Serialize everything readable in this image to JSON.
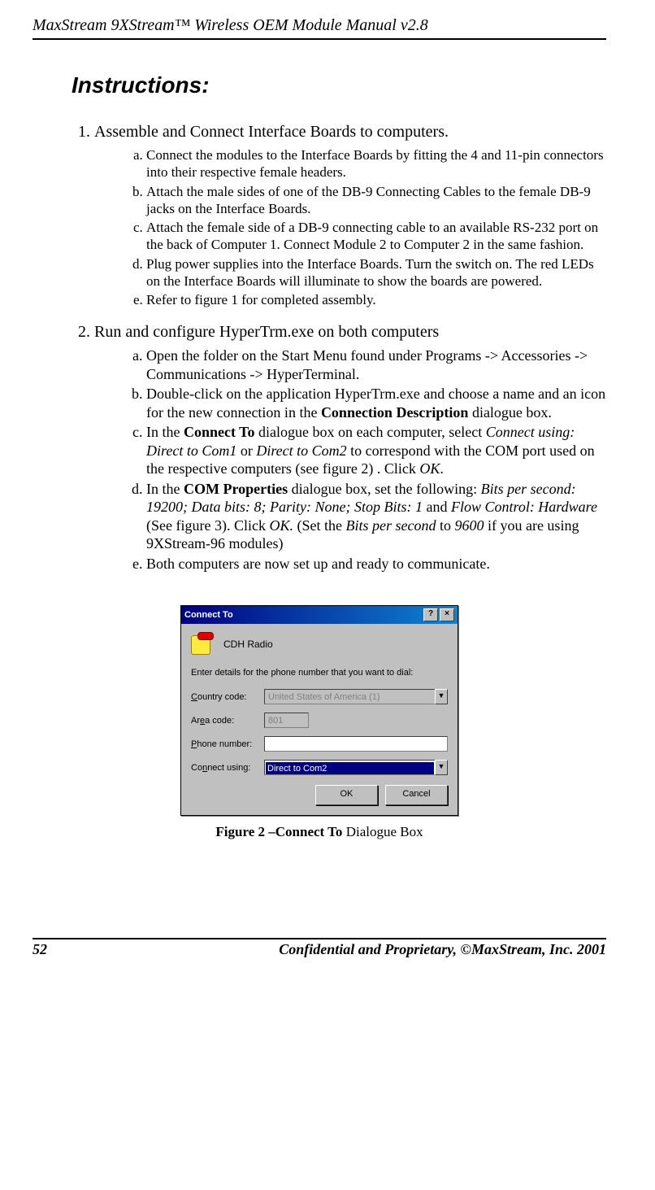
{
  "header": {
    "title": "MaxStream 9XStream™ Wireless OEM Module Manual v2.8"
  },
  "section_title": "Instructions:",
  "steps": [
    {
      "title": "Assemble and Connect Interface Boards to computers.",
      "subs": [
        "Connect the modules to the Interface Boards by fitting the 4 and 11-pin connectors into their respective female headers.",
        "Attach the male sides of one of the DB-9 Connecting Cables to the female DB-9 jacks on the Interface Boards.",
        "Attach the female side of a DB-9 connecting cable to an available RS-232 port on the back of Computer 1. Connect Module 2 to Computer 2 in the same fashion.",
        "Plug power supplies into the Interface Boards. Turn the switch on. The red LEDs on the Interface Boards will illuminate to show the boards are powered.",
        "Refer to figure 1 for completed assembly."
      ]
    },
    {
      "title": "Run and configure HyperTrm.exe on both computers",
      "subs": [
        {
          "plain": "Open the folder on the Start Menu found under Programs -> Accessories -> Communications -> HyperTerminal."
        },
        {
          "pre": "Double-click on the application HyperTrm.exe and choose a name and an icon for the new connection in the ",
          "bold": "Connection Description",
          "post": " dialogue box."
        },
        {
          "c_pre": "In the ",
          "c_b": "Connect To",
          "c_post1": " dialogue box on each computer, select ",
          "c_i1": "Connect using: Direct to Com1",
          "c_mid1": " or ",
          "c_i2": "Direct to Com2",
          "c_post2": " to correspond with the COM port used on the respective computers (see figure 2) . Click ",
          "c_i3": "OK",
          "c_post3": "."
        },
        {
          "d_pre": "In the ",
          "d_b": "COM Properties",
          "d_post1": " dialogue box, set the following: ",
          "d_i1": "Bits per second: 19200; Data bits: 8; Parity: None; Stop Bits: 1",
          "d_mid1": " and ",
          "d_i2": "Flow Control: Hardware",
          "d_mid2": " (See figure 3). Click ",
          "d_i3": "OK.",
          "d_mid3": " (Set the ",
          "d_i4": "Bits per second",
          "d_mid4": " to ",
          "d_i5": "9600",
          "d_post2": " if you are using 9XStream-96 modules)"
        },
        {
          "plain": "Both computers are now set up and ready to communicate."
        }
      ]
    }
  ],
  "dialog": {
    "window_title": "Connect To",
    "help_glyph": "?",
    "close_glyph": "×",
    "connection_name": "CDH Radio",
    "instruction": "Enter details for the phone number that you want to dial:",
    "labels": {
      "country": "Country code:",
      "area": "Area code:",
      "phone": "Phone number:",
      "using": "Connect using:"
    },
    "values": {
      "country": "United States of America (1)",
      "area": "801",
      "phone": "",
      "using": "Direct to Com2"
    },
    "dropdown_arrow": "▼",
    "buttons": {
      "ok": "OK",
      "cancel": "Cancel"
    }
  },
  "figure_caption": {
    "lead": "Figure 2 –",
    "bold": "Connect To",
    "tail": " Dialogue Box"
  },
  "footer": {
    "page": "52",
    "copy": "Confidential and Proprietary, ©MaxStream, Inc. 2001"
  }
}
